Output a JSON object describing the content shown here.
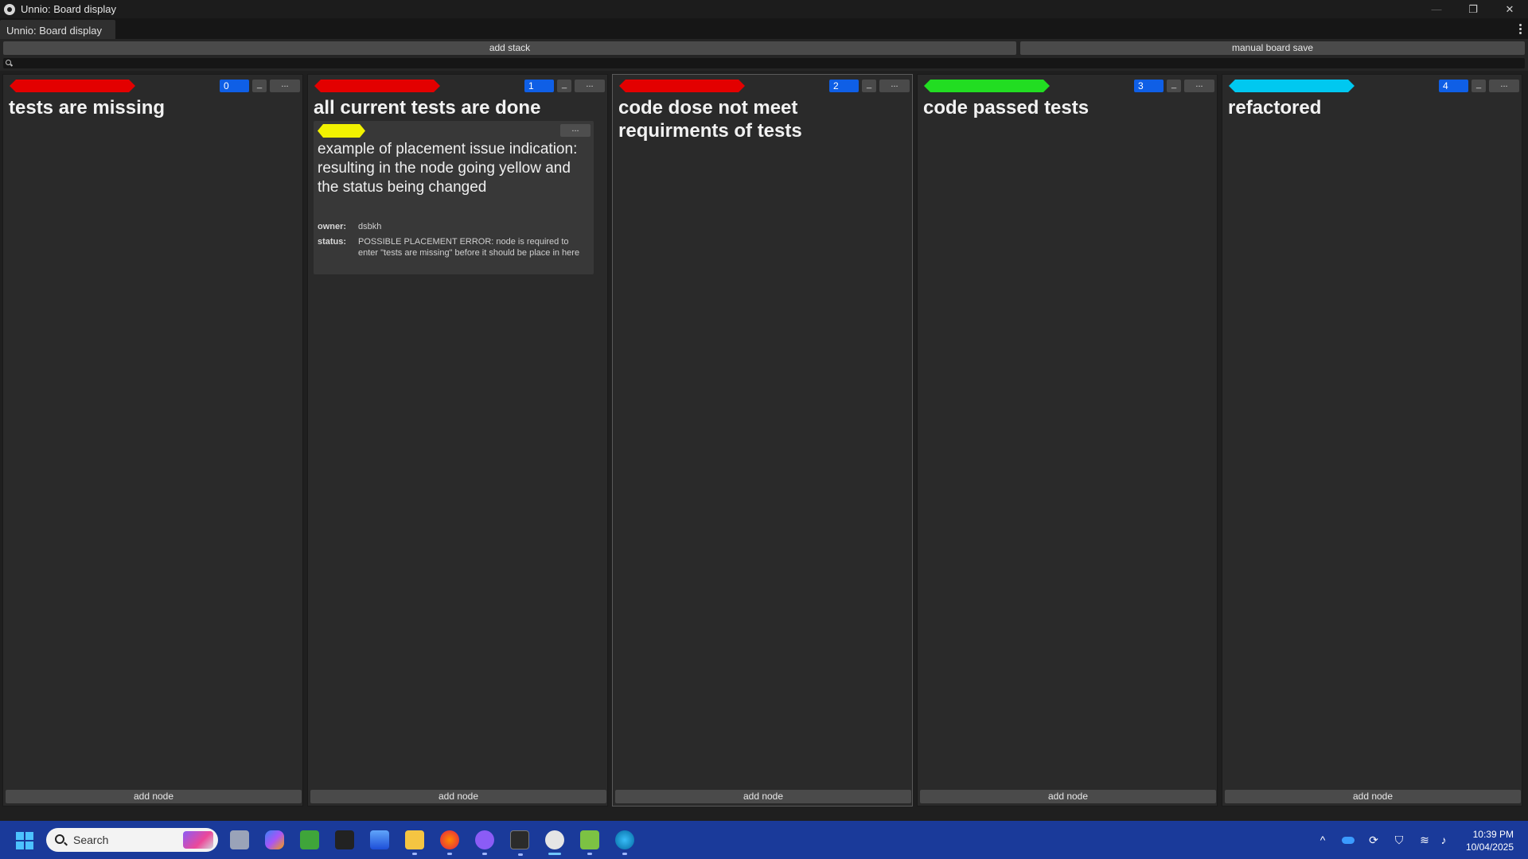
{
  "window": {
    "title": "Unnio: Board display",
    "controls": {
      "minimize": "—",
      "restore": "❐",
      "close": "✕"
    }
  },
  "tab": {
    "label": "Unnio: Board display"
  },
  "toolbar": {
    "add_stack_label": "add stack",
    "manual_save_label": "manual board save",
    "search_value": ""
  },
  "stacks": [
    {
      "title": "tests are missing",
      "tag_color": "#e30000",
      "count": "0",
      "minimize": "_",
      "more": "...",
      "add_node": "add node"
    },
    {
      "title": "all current tests are done",
      "tag_color": "#e30000",
      "count": "1",
      "minimize": "_",
      "more": "...",
      "add_node": "add node",
      "nodes": [
        {
          "tag_color": "#f2f200",
          "more": "...",
          "title": "example of placement issue indication: resulting in the node going yellow and the status being changed",
          "owner_label": "owner:",
          "owner": "dsbkh",
          "status_label": "status:",
          "status": "POSSIBLE PLACEMENT ERROR: node is required to enter \"tests are missing\" before it should be place in here"
        }
      ]
    },
    {
      "title": "code dose not meet requirments of tests",
      "tag_color": "#e30000",
      "count": "2",
      "minimize": "_",
      "more": "...",
      "add_node": "add node"
    },
    {
      "title": "code passed tests",
      "tag_color": "#22dd22",
      "count": "3",
      "minimize": "_",
      "more": "...",
      "add_node": "add node"
    },
    {
      "title": "refactored",
      "tag_color": "#00c8f0",
      "count": "4",
      "minimize": "_",
      "more": "...",
      "add_node": "add node"
    }
  ],
  "taskbar": {
    "search_placeholder": "Search",
    "apps": [
      "task-view-icon",
      "copilot-icon",
      "minecraft-icon",
      "acer-icon",
      "photos-icon",
      "file-explorer-icon",
      "firefox-icon",
      "github-desktop-icon",
      "terminal-icon",
      "unnio-icon",
      "notepad-icon",
      "globe-icon"
    ],
    "tray_arrow": "^",
    "time": "10:39 PM",
    "date": "10/04/2025"
  }
}
